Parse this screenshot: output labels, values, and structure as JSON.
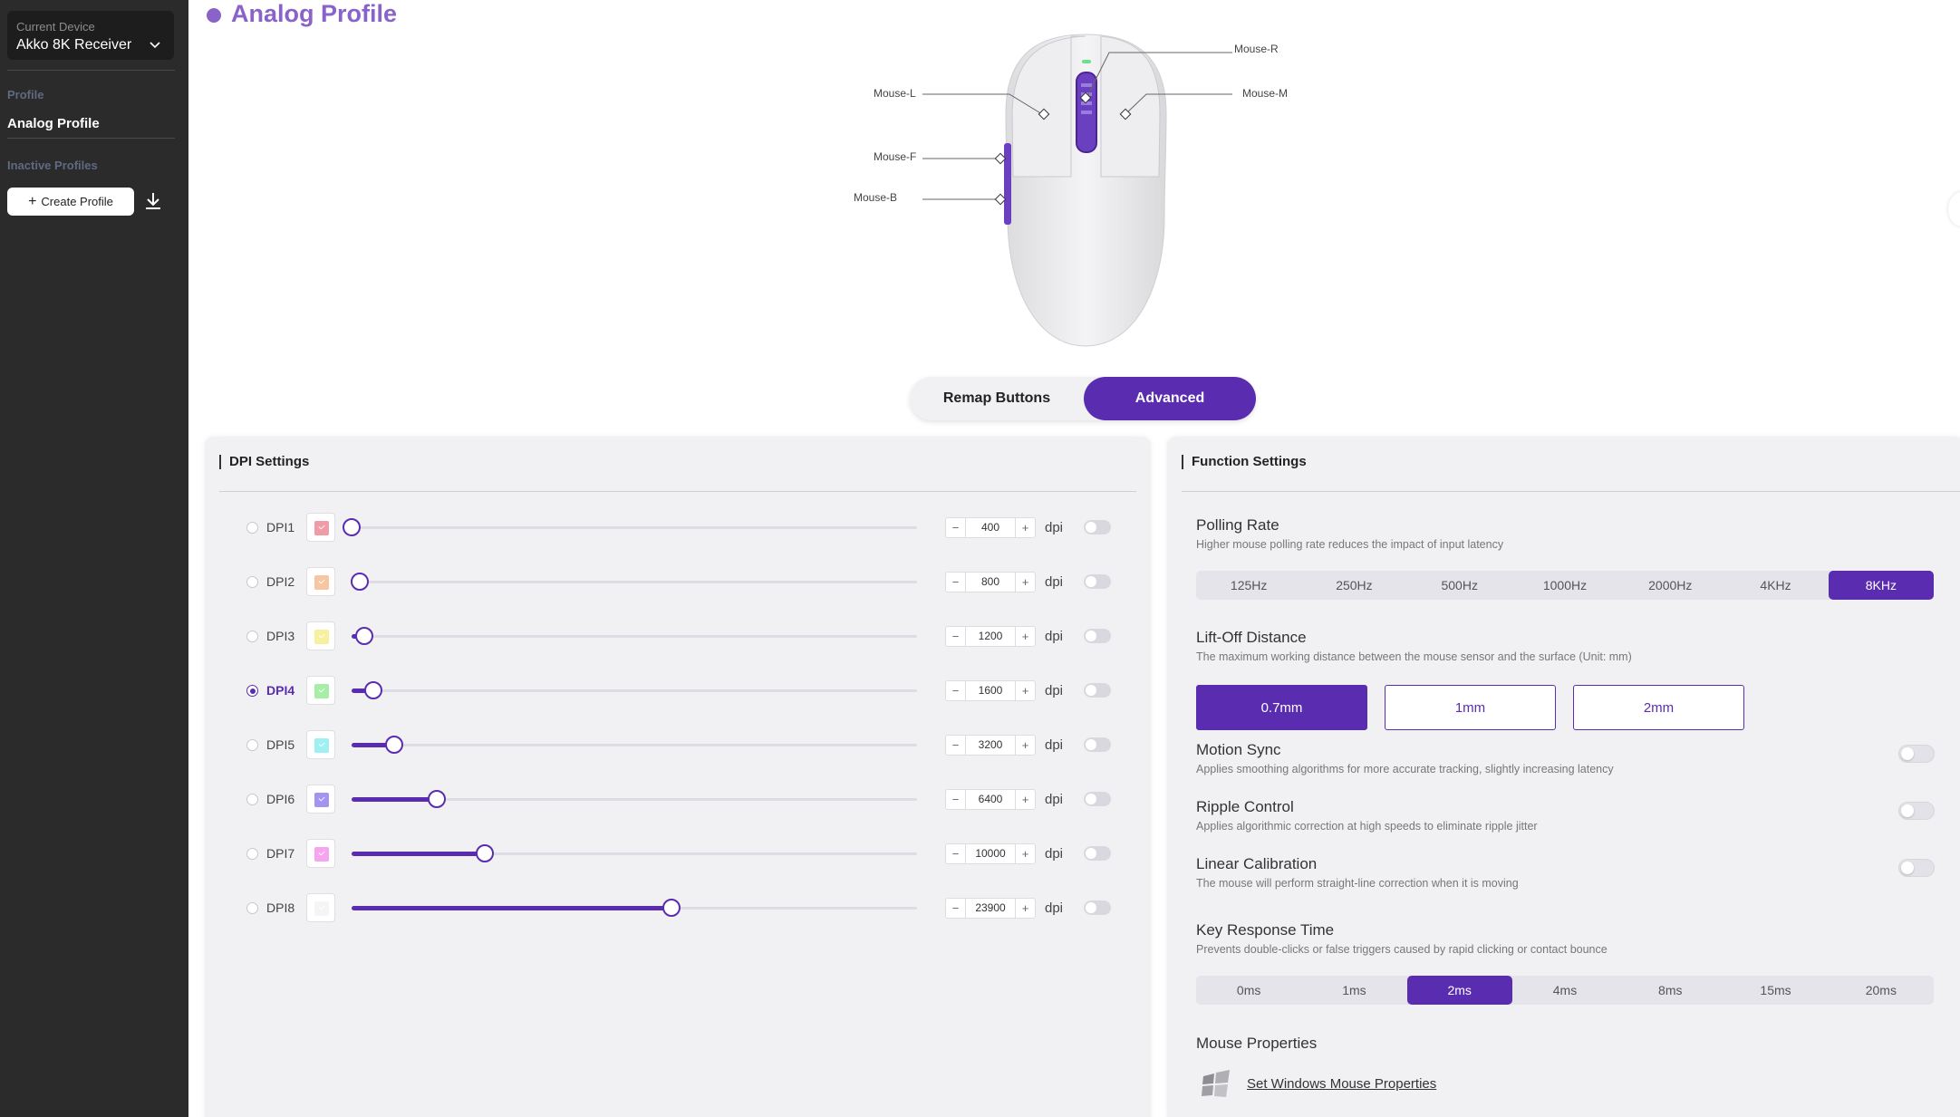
{
  "sidebar": {
    "current_device_label": "Current Device",
    "device_name": "Akko 8K Receiver",
    "profile_section": "Profile",
    "active_profile": "Analog Profile",
    "inactive_section": "Inactive Profiles",
    "create_profile": "Create Profile"
  },
  "page_title": "Analog Profile",
  "mouse_labels": {
    "right": "Mouse-R",
    "left": "Mouse-L",
    "middle": "Mouse-M",
    "forward": "Mouse-F",
    "back": "Mouse-B"
  },
  "tabs": [
    {
      "label": "Remap Buttons",
      "active": false
    },
    {
      "label": "Advanced",
      "active": true
    }
  ],
  "dpi": {
    "title": "DPI Settings",
    "unit": "dpi",
    "max": 26000,
    "rows": [
      {
        "name": "DPI1",
        "value": "400",
        "color": "#f19aa8",
        "selected": false
      },
      {
        "name": "DPI2",
        "value": "800",
        "color": "#f7c59f",
        "selected": false
      },
      {
        "name": "DPI3",
        "value": "1200",
        "color": "#f6f0a0",
        "selected": false
      },
      {
        "name": "DPI4",
        "value": "1600",
        "color": "#a6eea5",
        "selected": true
      },
      {
        "name": "DPI5",
        "value": "3200",
        "color": "#9ef0f2",
        "selected": false
      },
      {
        "name": "DPI6",
        "value": "6400",
        "color": "#a195f0",
        "selected": false
      },
      {
        "name": "DPI7",
        "value": "10000",
        "color": "#f7a4f0",
        "selected": false
      },
      {
        "name": "DPI8",
        "value": "23900",
        "color": "#f5f5f5",
        "selected": false
      }
    ],
    "levels": [
      0.0,
      0.015,
      0.023,
      0.038,
      0.075,
      0.15,
      0.235,
      0.565
    ]
  },
  "function": {
    "title": "Function Settings",
    "polling": {
      "label": "Polling Rate",
      "desc": "Higher mouse polling rate reduces the impact of input latency",
      "options": [
        "125Hz",
        "250Hz",
        "500Hz",
        "1000Hz",
        "2000Hz",
        "4KHz",
        "8KHz"
      ],
      "selected": "8KHz"
    },
    "lift": {
      "label": "Lift-Off Distance",
      "desc": "The maximum working distance between the mouse sensor and the surface (Unit: mm)",
      "options": [
        "0.7mm",
        "1mm",
        "2mm"
      ],
      "selected": "0.7mm"
    },
    "motion_sync": {
      "label": "Motion Sync",
      "desc": "Applies smoothing algorithms for more accurate tracking, slightly increasing latency"
    },
    "ripple": {
      "label": "Ripple Control",
      "desc": "Applies algorithmic correction at high speeds to eliminate ripple jitter"
    },
    "linear": {
      "label": "Linear Calibration",
      "desc": "The mouse will perform straight-line correction when it is moving"
    },
    "key_response": {
      "label": "Key Response Time",
      "desc": "Prevents double-clicks or false triggers caused by rapid clicking or contact bounce",
      "options": [
        "0ms",
        "1ms",
        "2ms",
        "4ms",
        "8ms",
        "15ms",
        "20ms"
      ],
      "selected": "2ms"
    },
    "mouse_props": {
      "label": "Mouse Properties",
      "link": "Set Windows Mouse Properties"
    }
  },
  "colors": {
    "accent": "#5a2db0",
    "title_accent": "#8a63c9",
    "sidebar_bg": "#2b2b2b"
  }
}
